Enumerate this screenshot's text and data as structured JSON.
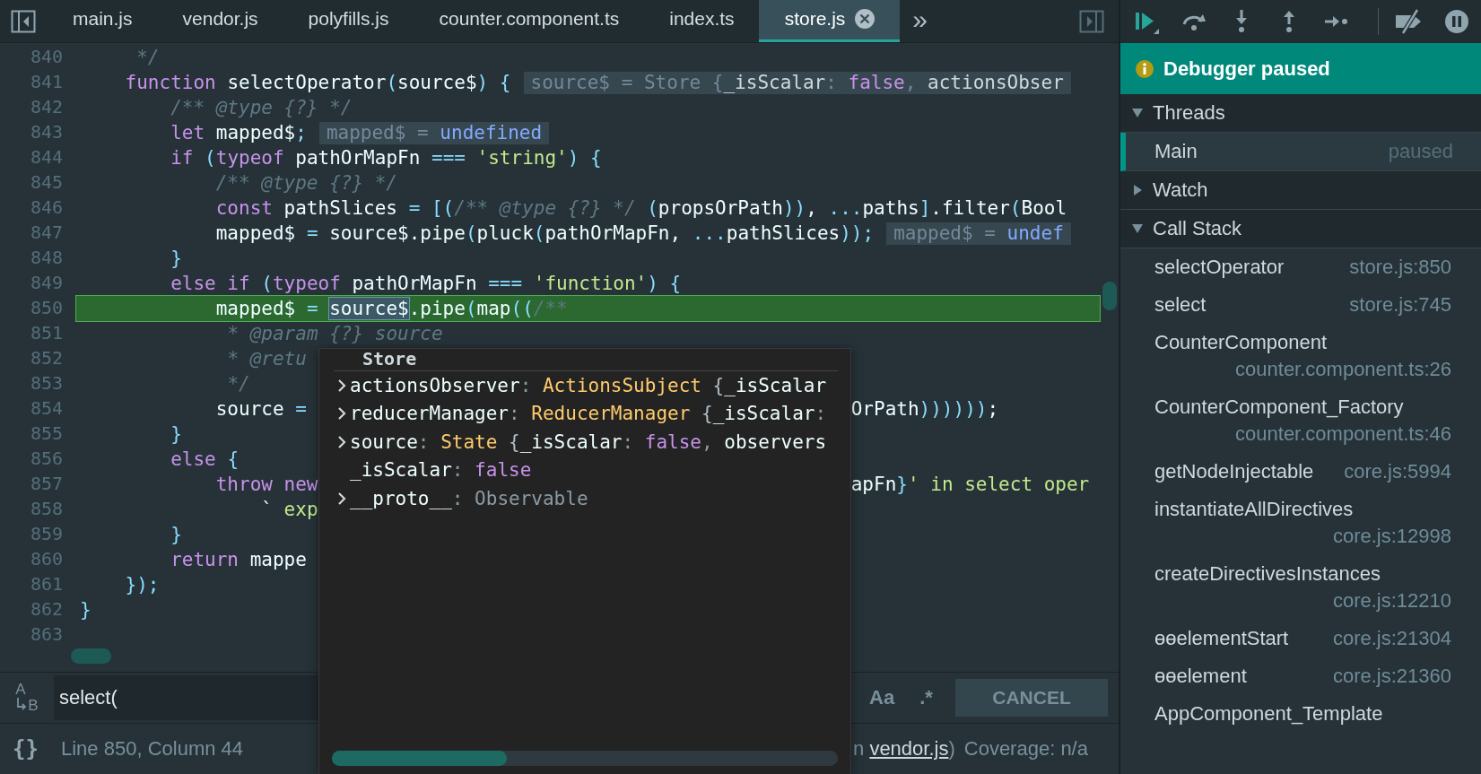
{
  "tabs": [
    {
      "label": "main.js",
      "selected": false
    },
    {
      "label": "vendor.js",
      "selected": false
    },
    {
      "label": "polyfills.js",
      "selected": false
    },
    {
      "label": "counter.component.ts",
      "selected": false
    },
    {
      "label": "index.ts",
      "selected": false
    },
    {
      "label": "store.js",
      "selected": true
    }
  ],
  "tab_overflow": "»",
  "editor": {
    "lines": [
      {
        "number": "840",
        "current": false,
        "tokens": [
          {
            "kind": "comment",
            "text": "     */"
          }
        ]
      },
      {
        "number": "841",
        "current": false,
        "tokens": [
          {
            "kind": "keyword",
            "text": "    function"
          },
          {
            "kind": "plain",
            "text": " selectOperator"
          },
          {
            "kind": "punct",
            "text": "("
          },
          {
            "kind": "plain",
            "text": "source$"
          },
          {
            "kind": "punct",
            "text": ")"
          },
          {
            "kind": "punct",
            "text": " {"
          }
        ],
        "hint": [
          {
            "kind": "label",
            "text": "source$ = Store {"
          },
          {
            "kind": "value",
            "text": "_isScalar"
          },
          {
            "kind": "label",
            "text": ": "
          },
          {
            "kind": "boolean",
            "text": "false"
          },
          {
            "kind": "label",
            "text": ", "
          },
          {
            "kind": "value",
            "text": "actionsObser"
          }
        ]
      },
      {
        "number": "842",
        "current": false,
        "tokens": [
          {
            "kind": "comment",
            "text": "        /** @type {?} */"
          }
        ]
      },
      {
        "number": "843",
        "current": false,
        "tokens": [
          {
            "kind": "keyword",
            "text": "        let"
          },
          {
            "kind": "plain",
            "text": " mapped$"
          },
          {
            "kind": "punct",
            "text": ";"
          }
        ],
        "hint": [
          {
            "kind": "label",
            "text": "mapped$ = "
          },
          {
            "kind": "undefined",
            "text": "undefined"
          }
        ]
      },
      {
        "number": "844",
        "current": false,
        "tokens": [
          {
            "kind": "keyword",
            "text": "        if"
          },
          {
            "kind": "punct",
            "text": " ("
          },
          {
            "kind": "keyword",
            "text": "typeof"
          },
          {
            "kind": "plain",
            "text": " pathOrMapFn "
          },
          {
            "kind": "punct",
            "text": "==="
          },
          {
            "kind": "string",
            "text": " 'string'"
          },
          {
            "kind": "punct",
            "text": ")"
          },
          {
            "kind": "punct",
            "text": " {"
          }
        ]
      },
      {
        "number": "845",
        "current": false,
        "tokens": [
          {
            "kind": "comment",
            "text": "            /** @type {?} */"
          }
        ]
      },
      {
        "number": "846",
        "current": false,
        "tokens": [
          {
            "kind": "keyword",
            "text": "            const"
          },
          {
            "kind": "plain",
            "text": " pathSlices "
          },
          {
            "kind": "punct",
            "text": "="
          },
          {
            "kind": "punct",
            "text": " [("
          },
          {
            "kind": "comment",
            "text": "/** @type {?} */"
          },
          {
            "kind": "punct",
            "text": " ("
          },
          {
            "kind": "plain",
            "text": "propsOrPath"
          },
          {
            "kind": "punct",
            "text": "))"
          },
          {
            "kind": "plain",
            "text": ", "
          },
          {
            "kind": "punct",
            "text": "..."
          },
          {
            "kind": "plain",
            "text": "paths"
          },
          {
            "kind": "punct",
            "text": "]"
          },
          {
            "kind": "plain",
            "text": ".filter"
          },
          {
            "kind": "punct",
            "text": "("
          },
          {
            "kind": "plain",
            "text": "Bool"
          }
        ]
      },
      {
        "number": "847",
        "current": false,
        "tokens": [
          {
            "kind": "plain",
            "text": "            mapped$ "
          },
          {
            "kind": "punct",
            "text": "="
          },
          {
            "kind": "plain",
            "text": " source$.pipe"
          },
          {
            "kind": "punct",
            "text": "("
          },
          {
            "kind": "plain",
            "text": "pluck"
          },
          {
            "kind": "punct",
            "text": "("
          },
          {
            "kind": "plain",
            "text": "pathOrMapFn, "
          },
          {
            "kind": "punct",
            "text": "..."
          },
          {
            "kind": "plain",
            "text": "pathSlices"
          },
          {
            "kind": "punct",
            "text": "));"
          }
        ],
        "hint": [
          {
            "kind": "label",
            "text": "mapped$ = "
          },
          {
            "kind": "undefined",
            "text": "undef"
          }
        ]
      },
      {
        "number": "848",
        "current": false,
        "tokens": [
          {
            "kind": "punct",
            "text": "        }"
          }
        ]
      },
      {
        "number": "849",
        "current": false,
        "tokens": [
          {
            "kind": "keyword",
            "text": "        else if"
          },
          {
            "kind": "punct",
            "text": " ("
          },
          {
            "kind": "keyword",
            "text": "typeof"
          },
          {
            "kind": "plain",
            "text": " pathOrMapFn "
          },
          {
            "kind": "punct",
            "text": "==="
          },
          {
            "kind": "string",
            "text": " 'function'"
          },
          {
            "kind": "punct",
            "text": ")"
          },
          {
            "kind": "punct",
            "text": " {"
          }
        ]
      },
      {
        "number": "850",
        "current": true,
        "tokens": [
          {
            "kind": "plain",
            "text": "            mapped$ "
          },
          {
            "kind": "punct",
            "text": "= "
          },
          {
            "kind": "selection",
            "text": "source$"
          },
          {
            "kind": "plain",
            "text": ".pipe"
          },
          {
            "kind": "punct",
            "text": "("
          },
          {
            "kind": "plain",
            "text": "map"
          },
          {
            "kind": "punct",
            "text": "(("
          },
          {
            "kind": "comment",
            "text": "/**"
          }
        ]
      },
      {
        "number": "851",
        "current": false,
        "tokens": [
          {
            "kind": "comment",
            "text": "             * @param {?} source"
          }
        ]
      },
      {
        "number": "852",
        "current": false,
        "tokens": [
          {
            "kind": "comment",
            "text": "             * @retu"
          }
        ]
      },
      {
        "number": "853",
        "current": false,
        "tokens": [
          {
            "kind": "comment",
            "text": "             */"
          }
        ]
      },
      {
        "number": "854",
        "current": false,
        "tokens": [
          {
            "kind": "plain",
            "text": "            source "
          },
          {
            "kind": "punct",
            "text": "="
          }
        ],
        "right": [
          {
            "kind": "plain",
            "text": "OrPath"
          },
          {
            "kind": "punct",
            "text": "))))))"
          },
          {
            "kind": "plain",
            "text": ";"
          }
        ]
      },
      {
        "number": "855",
        "current": false,
        "tokens": [
          {
            "kind": "punct",
            "text": "        }"
          }
        ]
      },
      {
        "number": "856",
        "current": false,
        "tokens": [
          {
            "kind": "keyword",
            "text": "        else"
          },
          {
            "kind": "punct",
            "text": " {"
          }
        ]
      },
      {
        "number": "857",
        "current": false,
        "tokens": [
          {
            "kind": "keyword",
            "text": "            throw"
          },
          {
            "kind": "keyword",
            "text": " new"
          }
        ],
        "right": [
          {
            "kind": "plain",
            "text": "apFn"
          },
          {
            "kind": "punct",
            "text": "}"
          },
          {
            "kind": "string",
            "text": "' in select oper"
          }
        ]
      },
      {
        "number": "858",
        "current": false,
        "tokens": [
          {
            "kind": "plain",
            "text": "                `"
          },
          {
            "kind": "string",
            "text": " exp"
          }
        ]
      },
      {
        "number": "859",
        "current": false,
        "tokens": [
          {
            "kind": "punct",
            "text": "        }"
          }
        ]
      },
      {
        "number": "860",
        "current": false,
        "tokens": [
          {
            "kind": "keyword",
            "text": "        return"
          },
          {
            "kind": "plain",
            "text": " mappe"
          }
        ]
      },
      {
        "number": "861",
        "current": false,
        "tokens": [
          {
            "kind": "punct",
            "text": "    });"
          }
        ]
      },
      {
        "number": "862",
        "current": false,
        "tokens": [
          {
            "kind": "punct",
            "text": "}"
          }
        ]
      },
      {
        "number": "863",
        "current": false
      }
    ]
  },
  "value_popover": {
    "title": "Store",
    "properties": [
      {
        "expandable": true,
        "tokens": [
          {
            "kind": "name",
            "text": "actionsObserver"
          },
          {
            "kind": "colon",
            "text": ": "
          },
          {
            "kind": "type",
            "text": "ActionsSubject"
          },
          {
            "kind": "brace",
            "text": " {"
          },
          {
            "kind": "name",
            "text": "_isScalar"
          }
        ]
      },
      {
        "expandable": true,
        "tokens": [
          {
            "kind": "name",
            "text": "reducerManager"
          },
          {
            "kind": "colon",
            "text": ": "
          },
          {
            "kind": "type",
            "text": "ReducerManager"
          },
          {
            "kind": "brace",
            "text": " {"
          },
          {
            "kind": "name",
            "text": "_isScalar"
          },
          {
            "kind": "colon",
            "text": ":"
          }
        ]
      },
      {
        "expandable": true,
        "tokens": [
          {
            "kind": "name",
            "text": "source"
          },
          {
            "kind": "colon",
            "text": ": "
          },
          {
            "kind": "type",
            "text": "State"
          },
          {
            "kind": "brace",
            "text": " {"
          },
          {
            "kind": "name",
            "text": "_isScalar"
          },
          {
            "kind": "colon",
            "text": ": "
          },
          {
            "kind": "boolean",
            "text": "false"
          },
          {
            "kind": "colon",
            "text": ", "
          },
          {
            "kind": "name",
            "text": "observers"
          }
        ]
      },
      {
        "expandable": false,
        "tokens": [
          {
            "kind": "name",
            "text": "_isScalar"
          },
          {
            "kind": "colon",
            "text": ": "
          },
          {
            "kind": "boolean",
            "text": "false"
          }
        ]
      },
      {
        "expandable": true,
        "tokens": [
          {
            "kind": "name",
            "text": "__proto__"
          },
          {
            "kind": "colon",
            "text": ": "
          },
          {
            "kind": "proto",
            "text": "Observable"
          }
        ]
      }
    ]
  },
  "search": {
    "replace_toggle": [
      "A",
      "B"
    ],
    "value": "select(",
    "case_toggle": "Aa",
    "regex_toggle": ".*",
    "cancel": "CANCEL"
  },
  "status": {
    "pretty_print": "{}",
    "position": "Line 850, Column 44",
    "source_prefix": "n",
    "source_link": "vendor.js",
    "source_suffix": ")",
    "coverage": "Coverage: n/a"
  },
  "debugger": {
    "banner": "Debugger paused",
    "sections": [
      {
        "title": "Threads",
        "expanded": true,
        "threads": [
          {
            "name": "Main",
            "status": "paused",
            "selected": true
          }
        ]
      },
      {
        "title": "Watch",
        "expanded": false
      },
      {
        "title": "Call Stack",
        "expanded": true,
        "frames": [
          {
            "name": "selectOperator",
            "location": "store.js:850"
          },
          {
            "name": "select",
            "location": "store.js:745"
          },
          {
            "name": "CounterComponent",
            "location": "counter.component.ts:26"
          },
          {
            "name": "CounterComponent_Factory",
            "location": "counter.component.ts:46"
          },
          {
            "name": "getNodeInjectable",
            "location": "core.js:5994"
          },
          {
            "name": "instantiateAllDirectives",
            "location": "core.js:12998"
          },
          {
            "name": "createDirectivesInstances",
            "location": "core.js:12210"
          },
          {
            "name": "ɵɵelementStart",
            "location": "core.js:21304"
          },
          {
            "name": "ɵɵelement",
            "location": "core.js:21360"
          },
          {
            "name": "AppComponent_Template"
          }
        ]
      }
    ]
  }
}
